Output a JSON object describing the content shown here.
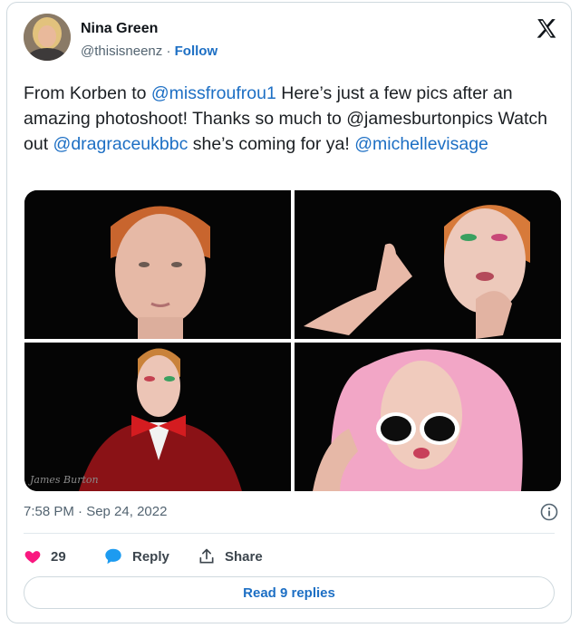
{
  "author": {
    "name": "Nina Green",
    "handle": "@thisisneenz",
    "separator": "·",
    "follow_label": "Follow"
  },
  "icons": {
    "platform": "x-logo-icon",
    "info": "info-icon",
    "like": "heart-icon",
    "reply": "speech-bubble-icon",
    "share": "share-upload-icon"
  },
  "tweet": {
    "segments": [
      {
        "text": "From Korben to ",
        "type": "text"
      },
      {
        "text": "@missfroufrou1",
        "type": "mention"
      },
      {
        "text": " Here’s just a few pics after an amazing photoshoot! Thanks so much to @jamesburtonpics Watch out ",
        "type": "text"
      },
      {
        "text": "@dragraceukbbc",
        "type": "mention"
      },
      {
        "text": " she’s coming for ya! ",
        "type": "text"
      },
      {
        "text": "@michellevisage",
        "type": "mention"
      }
    ]
  },
  "photo_watermark": "James Burton",
  "timestamp": "7:58 PM · Sep 24, 2022",
  "actions": {
    "likes_count": "29",
    "reply_label": "Reply",
    "share_label": "Share"
  },
  "read_replies_label": "Read 9 replies",
  "colors": {
    "accent": "#1d6fc4",
    "like": "#f91880",
    "border": "#cfd9de",
    "muted": "#536471"
  }
}
